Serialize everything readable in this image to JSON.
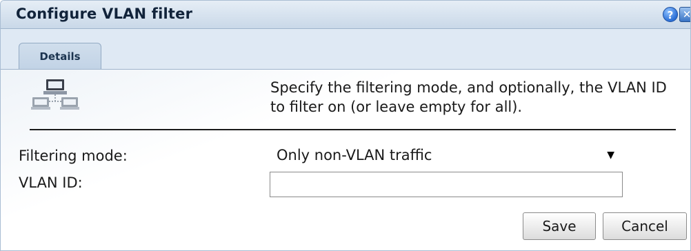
{
  "dialog": {
    "title": "Configure VLAN filter",
    "help_label": "?",
    "close_label": "✕"
  },
  "tabs": [
    {
      "label": "Details"
    }
  ],
  "details": {
    "icon": "network-computers-icon",
    "instructions": "Specify the filtering mode, and optionally, the VLAN ID to filter on (or leave empty for all)."
  },
  "form": {
    "filtering_mode_label": "Filtering mode:",
    "filtering_mode_value": "Only non-VLAN traffic",
    "vlan_id_label": "VLAN ID:",
    "vlan_id_value": ""
  },
  "buttons": {
    "save": "Save",
    "cancel": "Cancel"
  }
}
